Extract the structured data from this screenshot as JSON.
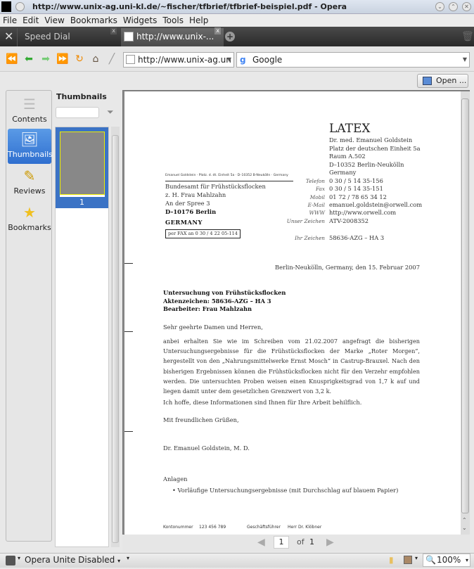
{
  "window": {
    "title": "http://www.unix-ag.uni-kl.de/~fischer/tfbrief/tfbrief-beispiel.pdf - Opera"
  },
  "menu": [
    "File",
    "Edit",
    "View",
    "Bookmarks",
    "Widgets",
    "Tools",
    "Help"
  ],
  "tabs": [
    {
      "label": "Speed Dial",
      "active": false
    },
    {
      "label": "http://www.unix-...",
      "active": true
    }
  ],
  "nav": {
    "address": "http://www.unix-ag.un",
    "search_engine": "Google"
  },
  "toolbar": {
    "open_label": "Open ..."
  },
  "sidebar": {
    "items": [
      {
        "label": "Contents",
        "icon": "contents-icon"
      },
      {
        "label": "Thumbnails",
        "icon": "thumbnails-icon",
        "active": true
      },
      {
        "label": "Reviews",
        "icon": "reviews-icon"
      },
      {
        "label": "Bookmarks",
        "icon": "bookmarks-icon"
      }
    ]
  },
  "thumbnails": {
    "heading": "Thumbnails",
    "filter_value": "",
    "pages": [
      "1"
    ]
  },
  "letter": {
    "logo": "LATEX",
    "sender": [
      "Dr. med. Emanuel Goldstein",
      "Platz der deutschen Einheit 5a",
      "Raum A.502",
      "D–10352 Berlin-Neukölln",
      "Germany"
    ],
    "contact": [
      {
        "label": "Telefon",
        "value": "0 30 / 5 14 35-156"
      },
      {
        "label": "Fax",
        "value": "0 30 / 5 14 35-151"
      },
      {
        "label": "Mobil",
        "value": "01 72 / 78 65 34 12"
      },
      {
        "label": "E-Mail",
        "value": "emanuel.goldstein@orwell.com"
      },
      {
        "label": "WWW",
        "value": "http://www.orwell.com"
      },
      {
        "label": "Unser Zeichen",
        "value": "ATV-2008352"
      }
    ],
    "ihr_zeichen": {
      "label": "Ihr Zeichen",
      "value": "58636-AZG – HA 3"
    },
    "return_line": "Emanuel Goldstein · Platz. d. dt. Einheit 5a · D–10352 B-Neukölln · Germany",
    "recipient": [
      "Bundesamt für Frühstücksflocken",
      "z. H. Frau Mahlzahn",
      "An der Spree 3",
      "D–10176 Berlin",
      "GERMANY"
    ],
    "fax_note": "per FAX an 0 30 / 4 22 05-114",
    "date": "Berlin-Neukölln, Germany, den 15. Februar 2007",
    "subject": [
      "Untersuchung von Frühstücksflocken",
      "Aktenzeichen: 58636-AZG – HA 3",
      "Bearbeiter: Frau Mahlzahn"
    ],
    "salutation": "Sehr geehrte Damen und Herren,",
    "body": "anbei erhalten Sie wie im Schreiben vom 21.02.2007 angefragt die bisherigen Untersuchungsergebnisse für die Frühstücksflocken der Marke „Roter Morgen“, hergestellt von den „Nahrungsmittelwerke Ernst Mosch“ in Castrup-Brauxel. Nach den bisherigen Ergebnissen können die Frühstücksflocken nicht für den Verzehr empfohlen werden. Die untersuchten Proben weisen einen Knusprigkeitsgrad von 1,7 k auf und liegen damit unter dem gesetzlichen Grenzwert von 3,2 k.",
    "body2": "Ich hoffe, diese Informationen sind Ihnen für Ihre Arbeit behilflich.",
    "closing": "Mit freundlichen Grüßen,",
    "signature": "Dr. Emanuel Goldstein, M. D.",
    "enclosures_label": "Anlagen",
    "enclosures": [
      "Vorläufige Untersuchungsergebnisse (mit Durchschlag auf blauem Papier)"
    ],
    "footer": [
      {
        "label": "Kontonummer",
        "value": "123 456 789"
      },
      {
        "label": "Geschäftsführer",
        "value": "Herr Dr. Klöbner"
      }
    ]
  },
  "pagenav": {
    "current": "1",
    "of_label": "of",
    "total": "1"
  },
  "status": {
    "unite": "Opera Unite Disabled",
    "zoom": "100%"
  }
}
